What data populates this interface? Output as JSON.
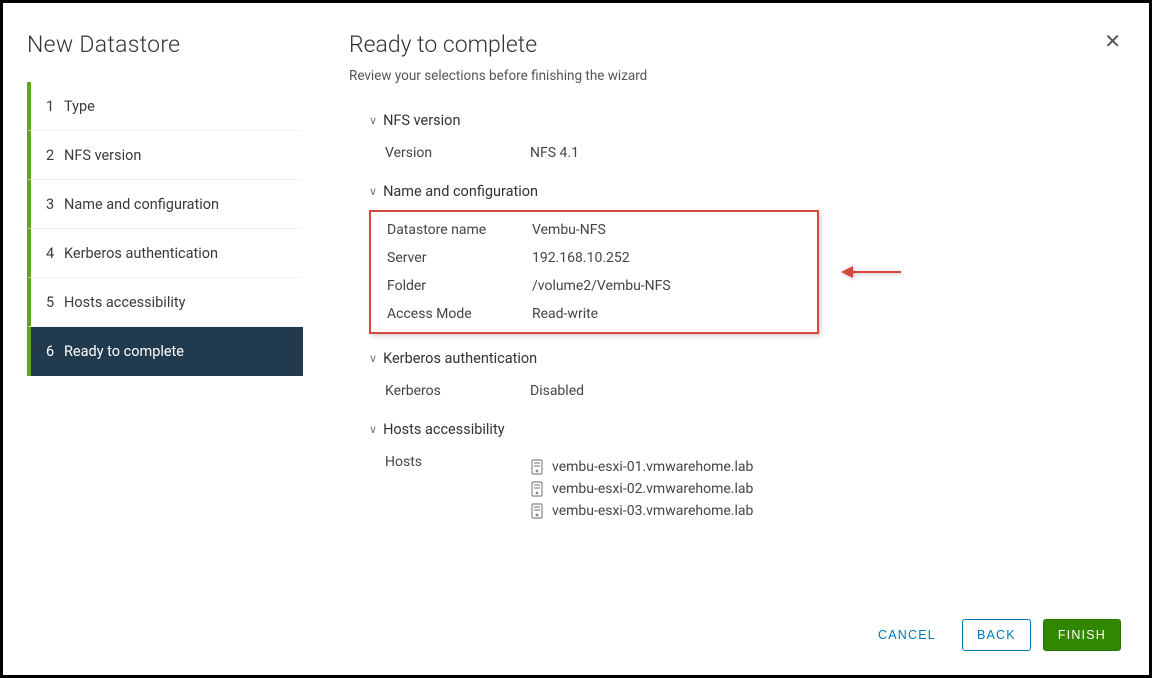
{
  "sidebar": {
    "title": "New Datastore",
    "steps": [
      {
        "num": "1",
        "label": "Type"
      },
      {
        "num": "2",
        "label": "NFS version"
      },
      {
        "num": "3",
        "label": "Name and configuration"
      },
      {
        "num": "4",
        "label": "Kerberos authentication"
      },
      {
        "num": "5",
        "label": "Hosts accessibility"
      },
      {
        "num": "6",
        "label": "Ready to complete"
      }
    ]
  },
  "header": {
    "title": "Ready to complete",
    "subtitle": "Review your selections before finishing the wizard"
  },
  "sections": {
    "nfs_version": {
      "title": "NFS version",
      "rows": [
        {
          "label": "Version",
          "value": "NFS 4.1"
        }
      ]
    },
    "name_config": {
      "title": "Name and configuration",
      "rows": [
        {
          "label": "Datastore name",
          "value": "Vembu-NFS"
        },
        {
          "label": "Server",
          "value": "192.168.10.252"
        },
        {
          "label": "Folder",
          "value": "/volume2/Vembu-NFS"
        },
        {
          "label": "Access Mode",
          "value": "Read-write"
        }
      ]
    },
    "kerberos": {
      "title": "Kerberos authentication",
      "rows": [
        {
          "label": "Kerberos",
          "value": "Disabled"
        }
      ]
    },
    "hosts": {
      "title": "Hosts accessibility",
      "label": "Hosts",
      "items": [
        "vembu-esxi-01.vmwarehome.lab",
        "vembu-esxi-02.vmwarehome.lab",
        "vembu-esxi-03.vmwarehome.lab"
      ]
    }
  },
  "footer": {
    "cancel": "CANCEL",
    "back": "BACK",
    "finish": "FINISH"
  }
}
